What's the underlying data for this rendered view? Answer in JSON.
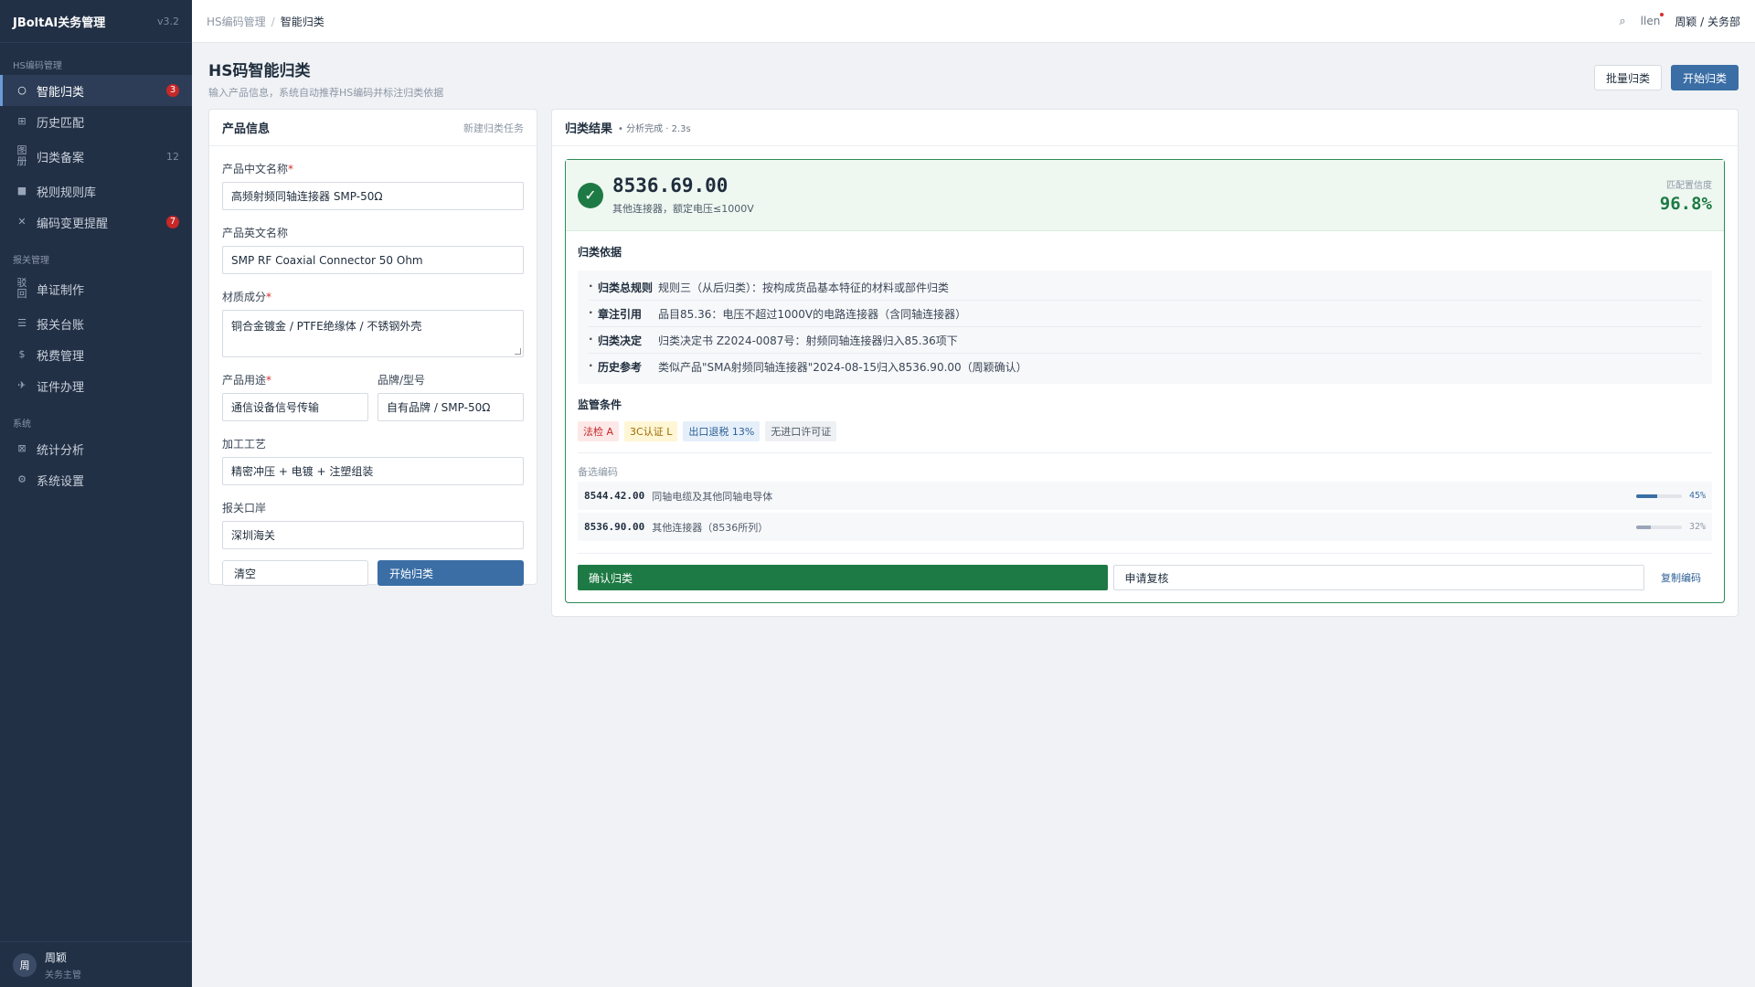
{
  "app": {
    "title": "JBoltAI关务管理",
    "version": "v3.2"
  },
  "sidebar": {
    "groups": [
      {
        "label": "HS编码管理",
        "items": [
          {
            "icon": "○",
            "label": "智能归类",
            "badge": "3",
            "active": true
          },
          {
            "icon": "⊞",
            "label": "历史匹配"
          },
          {
            "icon": "图\n册",
            "label": "归类备案",
            "count": "12"
          },
          {
            "icon": "■",
            "label": "税则规则库"
          },
          {
            "icon": "✕",
            "label": "编码变更提醒",
            "badge": "7"
          }
        ]
      },
      {
        "label": "报关管理",
        "items": [
          {
            "icon": "驳\n回",
            "label": "单证制作"
          },
          {
            "icon": "☰",
            "label": "报关台账"
          },
          {
            "icon": "$",
            "label": "税费管理"
          },
          {
            "icon": "✈",
            "label": "证件办理"
          }
        ]
      },
      {
        "label": "系统",
        "items": [
          {
            "icon": "⊠",
            "label": "统计分析"
          },
          {
            "icon": "⚙",
            "label": "系统设置"
          }
        ]
      }
    ],
    "user": {
      "avatar": "周",
      "name": "周颖",
      "role": "关务主管"
    }
  },
  "topbar": {
    "breadcrumb": [
      "HS编码管理",
      "智能归类"
    ],
    "search_icon": "⌕",
    "bell_text": "llen",
    "user_dept": "周颖 / 关务部"
  },
  "page": {
    "title": "HS码智能归类",
    "subtitle": "输入产品信息，系统自动推荐HS编码并标注归类依据",
    "batch_btn": "批量归类",
    "start_btn": "开始归类"
  },
  "form": {
    "title": "产品信息",
    "new_task": "新建归类任务",
    "name_cn_label": "产品中文名称",
    "name_cn": "高频射频同轴连接器 SMP-50Ω",
    "name_en_label": "产品英文名称",
    "name_en": "SMP RF Coaxial Connector 50 Ohm",
    "material_label": "材质成分",
    "material": "铜合金镀金 / PTFE绝缘体 / 不锈钢外壳",
    "usage_label": "产品用途",
    "usage": "通信设备信号传输",
    "brand_label": "品牌/型号",
    "brand": "自有品牌 / SMP-50Ω",
    "process_label": "加工工艺",
    "process": "精密冲压 + 电镀 + 注塑组装",
    "port_label": "报关口岸",
    "port": "深圳海关",
    "clear_btn": "清空",
    "submit_btn": "开始归类"
  },
  "result": {
    "title": "归类结果",
    "status": "• 分析完成 · 2.3s",
    "code": "8536.69.00",
    "code_desc": "其他连接器，额定电压≤1000V",
    "conf_label": "匹配置信度",
    "conf_value": "96.8%",
    "basis_title": "归类依据",
    "basis": [
      {
        "key": "归类总规则",
        "value": "规则三（从后归类）：按构成货品基本特征的材料或部件归类"
      },
      {
        "key": "章注引用",
        "value": "品目85.36：电压不超过1000V的电路连接器（含同轴连接器）"
      },
      {
        "key": "归类决定",
        "value": "归类决定书 Z2024-0087号：射频同轴连接器归入85.36项下"
      },
      {
        "key": "历史参考",
        "value": "类似产品\"SMA射频同轴连接器\"2024-08-15归入8536.90.00（周颖确认）"
      }
    ],
    "supervision_title": "监管条件",
    "tags": [
      {
        "text": "法检 A",
        "style": "red"
      },
      {
        "text": "3C认证 L",
        "style": "yellow"
      },
      {
        "text": "出口退税 13%",
        "style": "blue"
      },
      {
        "text": "无进口许可证",
        "style": "gray"
      }
    ],
    "alt_title": "备选编码",
    "alternatives": [
      {
        "code": "8544.42.00",
        "desc": "同轴电缆及其他同轴电导体",
        "pct": "45%",
        "value": 0.45
      },
      {
        "code": "8536.90.00",
        "desc": "其他连接器（8536所列）",
        "pct": "32%",
        "value": 0.32
      }
    ],
    "confirm_btn": "确认归类",
    "review_btn": "申请复核",
    "copy_btn": "复制编码"
  }
}
